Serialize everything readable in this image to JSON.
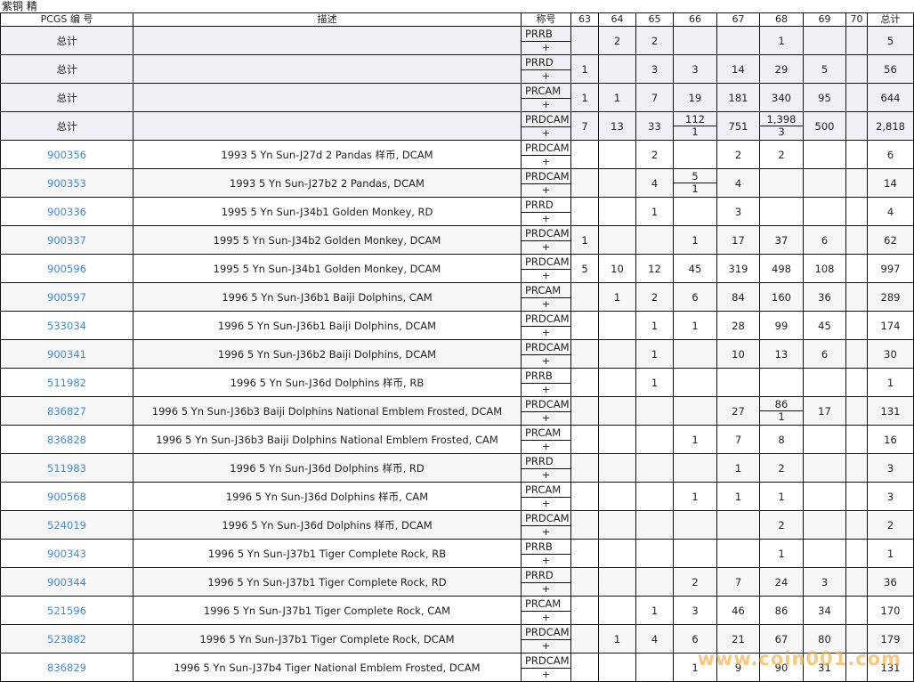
{
  "page_title": "紫铜 精",
  "headers": {
    "pcgs": "PCGS 编 号",
    "desc": "描述",
    "designation": "称号",
    "grades": [
      "63",
      "64",
      "65",
      "66",
      "67",
      "68",
      "69",
      "70"
    ],
    "total": "总计"
  },
  "rows": [
    {
      "type": "total",
      "id": "总计",
      "desc": "",
      "des": "PRRB",
      "sub": "+",
      "cells": [
        "",
        "2",
        "2",
        "",
        "",
        "1",
        "",
        ""
      ],
      "total": "5"
    },
    {
      "type": "total",
      "id": "总计",
      "desc": "",
      "des": "PRRD",
      "sub": "+",
      "cells": [
        "1",
        "",
        "3",
        "3",
        "14",
        "29",
        "5",
        ""
      ],
      "total": "56"
    },
    {
      "type": "total",
      "id": "总计",
      "desc": "",
      "des": "PRCAM",
      "sub": "+",
      "cells": [
        "1",
        "1",
        "7",
        "19",
        "181",
        "340",
        "95",
        ""
      ],
      "total": "644"
    },
    {
      "type": "total",
      "id": "总计",
      "desc": "",
      "des": "PRDCAM",
      "sub": "+",
      "cells": [
        "7",
        "13",
        "33",
        {
          "top": "112",
          "bot": "1"
        },
        "751",
        {
          "top": "1,398",
          "bot": "3"
        },
        "500",
        ""
      ],
      "total": "2,818"
    },
    {
      "type": "item",
      "id": "900356",
      "desc": "1993 5 Yn Sun-J27d 2 Pandas 样币, DCAM",
      "des": "PRDCAM",
      "sub": "+",
      "cells": [
        "",
        "",
        "2",
        "",
        "2",
        "2",
        "",
        ""
      ],
      "total": "6"
    },
    {
      "type": "item",
      "id": "900353",
      "desc": "1993 5 Yn Sun-J27b2 2 Pandas, DCAM",
      "des": "PRDCAM",
      "sub": "+",
      "cells": [
        "",
        "",
        "4",
        {
          "top": "5",
          "bot": "1"
        },
        "4",
        "",
        "",
        ""
      ],
      "total": "14"
    },
    {
      "type": "item",
      "id": "900336",
      "desc": "1995 5 Yn Sun-J34b1 Golden Monkey, RD",
      "des": "PRRD",
      "sub": "+",
      "cells": [
        "",
        "",
        "1",
        "",
        "3",
        "",
        "",
        ""
      ],
      "total": "4"
    },
    {
      "type": "item",
      "id": "900337",
      "desc": "1995 5 Yn Sun-J34b2 Golden Monkey, DCAM",
      "des": "PRDCAM",
      "sub": "+",
      "cells": [
        "1",
        "",
        "",
        "1",
        "17",
        "37",
        "6",
        ""
      ],
      "total": "62"
    },
    {
      "type": "item",
      "id": "900596",
      "desc": "1995 5 Yn Sun-J34b1 Golden Monkey, DCAM",
      "des": "PRDCAM",
      "sub": "+",
      "cells": [
        "5",
        "10",
        "12",
        "45",
        "319",
        "498",
        "108",
        ""
      ],
      "total": "997"
    },
    {
      "type": "item",
      "id": "900597",
      "desc": "1996 5 Yn Sun-J36b1 Baiji Dolphins, CAM",
      "des": "PRCAM",
      "sub": "+",
      "cells": [
        "",
        "1",
        "2",
        "6",
        "84",
        "160",
        "36",
        ""
      ],
      "total": "289"
    },
    {
      "type": "item",
      "id": "533034",
      "desc": "1996 5 Yn Sun-J36b1 Baiji Dolphins, DCAM",
      "des": "PRDCAM",
      "sub": "+",
      "cells": [
        "",
        "",
        "1",
        "1",
        "28",
        "99",
        "45",
        ""
      ],
      "total": "174"
    },
    {
      "type": "item",
      "id": "900341",
      "desc": "1996 5 Yn Sun-J36b2 Baiji Dolphins, DCAM",
      "des": "PRDCAM",
      "sub": "+",
      "cells": [
        "",
        "",
        "1",
        "",
        "10",
        "13",
        "6",
        ""
      ],
      "total": "30"
    },
    {
      "type": "item",
      "id": "511982",
      "desc": "1996 5 Yn Sun-J36d Dolphins 样币, RB",
      "des": "PRRB",
      "sub": "+",
      "cells": [
        "",
        "",
        "1",
        "",
        "",
        "",
        "",
        ""
      ],
      "total": "1"
    },
    {
      "type": "item",
      "id": "836827",
      "desc": "1996 5 Yn Sun-J36b3 Baiji Dolphins National Emblem Frosted, DCAM",
      "des": "PRDCAM",
      "sub": "+",
      "cells": [
        "",
        "",
        "",
        "",
        "27",
        {
          "top": "86",
          "bot": "1"
        },
        "17",
        ""
      ],
      "total": "131"
    },
    {
      "type": "item",
      "id": "836828",
      "desc": "1996 5 Yn Sun-J36b3 Baiji Dolphins National Emblem Frosted, CAM",
      "des": "PRCAM",
      "sub": "+",
      "cells": [
        "",
        "",
        "",
        "1",
        "7",
        "8",
        "",
        ""
      ],
      "total": "16"
    },
    {
      "type": "item",
      "id": "511983",
      "desc": "1996 5 Yn Sun-J36d Dolphins 样币, RD",
      "des": "PRRD",
      "sub": "+",
      "cells": [
        "",
        "",
        "",
        "",
        "1",
        "2",
        "",
        ""
      ],
      "total": "3"
    },
    {
      "type": "item",
      "id": "900568",
      "desc": "1996 5 Yn Sun-J36d Dolphins 样币, CAM",
      "des": "PRCAM",
      "sub": "+",
      "cells": [
        "",
        "",
        "",
        "1",
        "1",
        "1",
        "",
        ""
      ],
      "total": "3"
    },
    {
      "type": "item",
      "id": "524019",
      "desc": "1996 5 Yn Sun-J36d Dolphins 样币, DCAM",
      "des": "PRDCAM",
      "sub": "+",
      "cells": [
        "",
        "",
        "",
        "",
        "",
        "2",
        "",
        ""
      ],
      "total": "2"
    },
    {
      "type": "item",
      "id": "900343",
      "desc": "1996 5 Yn Sun-J37b1 Tiger Complete Rock, RB",
      "des": "PRRB",
      "sub": "+",
      "cells": [
        "",
        "",
        "",
        "",
        "",
        "1",
        "",
        ""
      ],
      "total": "1"
    },
    {
      "type": "item",
      "id": "900344",
      "desc": "1996 5 Yn Sun-J37b1 Tiger Complete Rock, RD",
      "des": "PRRD",
      "sub": "+",
      "cells": [
        "",
        "",
        "",
        "2",
        "7",
        "24",
        "3",
        ""
      ],
      "total": "36"
    },
    {
      "type": "item",
      "id": "521596",
      "desc": "1996 5 Yn Sun-J37b1 Tiger Complete Rock, CAM",
      "des": "PRCAM",
      "sub": "+",
      "cells": [
        "",
        "",
        "1",
        "3",
        "46",
        "86",
        "34",
        ""
      ],
      "total": "170"
    },
    {
      "type": "item",
      "id": "523882",
      "desc": "1996 5 Yn Sun-J37b1 Tiger Complete Rock, DCAM",
      "des": "PRDCAM",
      "sub": "+",
      "cells": [
        "",
        "1",
        "4",
        "6",
        "21",
        "67",
        "80",
        ""
      ],
      "total": "179"
    },
    {
      "type": "item",
      "id": "836829",
      "desc": "1996 5 Yn Sun-J37b4 Tiger National Emblem Frosted, DCAM",
      "des": "PRDCAM",
      "sub": "+",
      "cells": [
        "",
        "",
        "",
        "1",
        "9",
        "90",
        "31",
        ""
      ],
      "total": "131"
    }
  ],
  "watermark": "www.coin001.com",
  "colors": {
    "link": "#3d8bd4",
    "total_bg": "#eef1f6",
    "alt_bg": "#f7f7f7",
    "watermark": "#f5aa3c"
  }
}
